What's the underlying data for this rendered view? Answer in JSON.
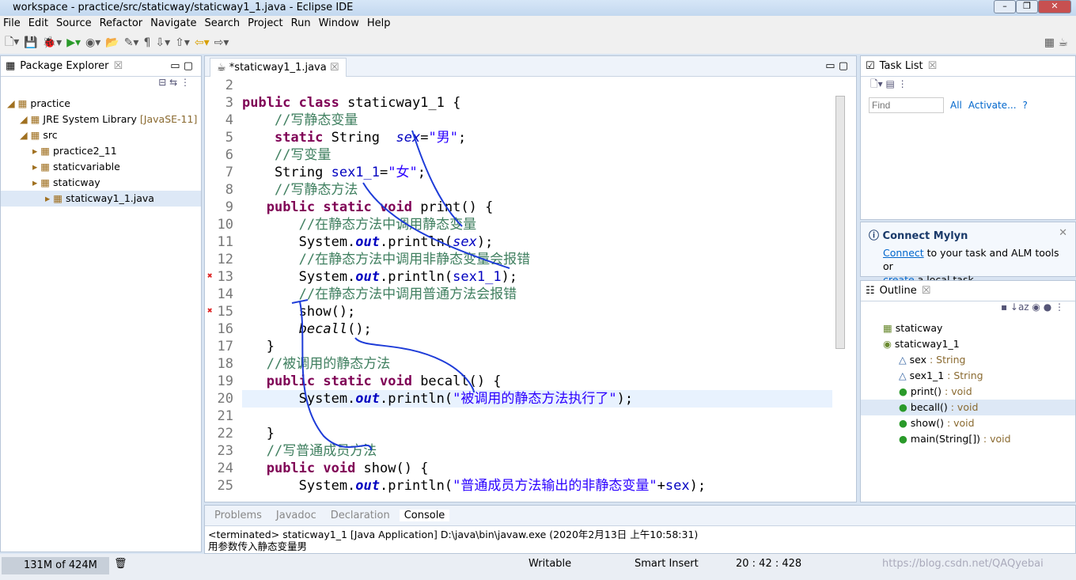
{
  "window": {
    "title": "workspace - practice/src/staticway/staticway1_1.java - Eclipse IDE"
  },
  "menu": [
    "File",
    "Edit",
    "Source",
    "Refactor",
    "Navigate",
    "Search",
    "Project",
    "Run",
    "Window",
    "Help"
  ],
  "package_explorer": {
    "title": "Package Explorer",
    "items": [
      {
        "label": "practice",
        "depth": 0
      },
      {
        "label": "JRE System Library",
        "suffix": "[JavaSE-11]",
        "depth": 1
      },
      {
        "label": "src",
        "depth": 1
      },
      {
        "label": "practice2_11",
        "depth": 2
      },
      {
        "label": "staticvariable",
        "depth": 2
      },
      {
        "label": "staticway",
        "depth": 2
      },
      {
        "label": "staticway1_1.java",
        "depth": 3
      }
    ]
  },
  "editor": {
    "tab": "*staticway1_1.java",
    "lines": [
      {
        "n": "2",
        "html": ""
      },
      {
        "n": "3",
        "html": "<span class='kw'>public class</span> staticway1_1 {"
      },
      {
        "n": "4",
        "html": "    <span class='cm'>//写静态变量</span>"
      },
      {
        "n": "5",
        "html": "    <span class='kw'>static</span> String  <span class='it' style='font-weight:normal'>sex</span>=<span class='st'>\"男\"</span>;"
      },
      {
        "n": "6",
        "html": "    <span class='cm'>//写变量</span>"
      },
      {
        "n": "7",
        "html": "    String <span class='fld'>sex1_1</span>=<span class='st'>\"女\"</span>;"
      },
      {
        "n": "8",
        "html": "    <span class='cm'>//写静态方法</span>"
      },
      {
        "n": "9",
        "html": "   <span class='kw'>public static void</span> print() {"
      },
      {
        "n": "10",
        "html": "       <span class='cm'>//在静态方法中调用静态变量</span>"
      },
      {
        "n": "11",
        "html": "       System.<span class='it'>out</span>.println(<span class='it' style='font-weight:normal'>sex</span>);"
      },
      {
        "n": "12",
        "html": "       <span class='cm'>//在静态方法中调用非静态变量会报错</span>"
      },
      {
        "n": "13",
        "html": "       System.<span class='it'>out</span>.println(<span class='fld'>sex1_1</span>);"
      },
      {
        "n": "14",
        "html": "       <span class='cm'>//在静态方法中调用普通方法会报错</span>"
      },
      {
        "n": "15",
        "html": "       show();"
      },
      {
        "n": "16",
        "html": "       <i>becall</i>();"
      },
      {
        "n": "17",
        "html": "   }"
      },
      {
        "n": "18",
        "html": "   <span class='cm'>//被调用的静态方法</span>"
      },
      {
        "n": "19",
        "html": "   <span class='kw'>public static void</span> becall() {"
      },
      {
        "n": "20",
        "html": "       System.<span class='it'>out</span>.println(<span class='st'>\"被调用的静态方法执行了\"</span>);"
      },
      {
        "n": "21",
        "html": ""
      },
      {
        "n": "22",
        "html": "   }"
      },
      {
        "n": "23",
        "html": "   <span class='cm'>//写普通成员方法</span>"
      },
      {
        "n": "24",
        "html": "   <span class='kw'>public void</span> show() {"
      },
      {
        "n": "25",
        "html": "       System.<span class='it'>out</span>.println(<span class='st'>\"普通成员方法输出的非静态变量\"</span>+<span class='fld'>sex</span>);"
      }
    ]
  },
  "task_list": {
    "title": "Task List",
    "find_placeholder": "Find",
    "all": "All",
    "activate": "Activate..."
  },
  "mylyn": {
    "title": "Connect Mylyn",
    "connect": "Connect",
    "text1": " to your task and ALM tools or",
    "create": "create",
    "text2": " a local task."
  },
  "outline": {
    "title": "Outline",
    "items": [
      {
        "label": "staticway",
        "type": "",
        "depth": 0
      },
      {
        "label": "staticway1_1",
        "type": "",
        "depth": 0
      },
      {
        "label": "sex",
        "type": " : String",
        "depth": 1
      },
      {
        "label": "sex1_1",
        "type": " : String",
        "depth": 1
      },
      {
        "label": "print()",
        "type": " : void",
        "depth": 1
      },
      {
        "label": "becall()",
        "type": " : void",
        "depth": 1
      },
      {
        "label": "show()",
        "type": " : void",
        "depth": 1
      },
      {
        "label": "main(String[])",
        "type": " : void",
        "depth": 1
      }
    ]
  },
  "console": {
    "tabs": [
      "Problems",
      "Javadoc",
      "Declaration",
      "Console"
    ],
    "header": "<terminated> staticway1_1 [Java Application] D:\\java\\bin\\javaw.exe (2020年2月13日 上午10:58:31)",
    "output": "用参数传入静态变量男"
  },
  "status": {
    "memory": "131M of 424M",
    "writable": "Writable",
    "mode": "Smart Insert",
    "position": "20 : 42 : 428",
    "watermark": "https://blog.csdn.net/QAQyebai"
  }
}
